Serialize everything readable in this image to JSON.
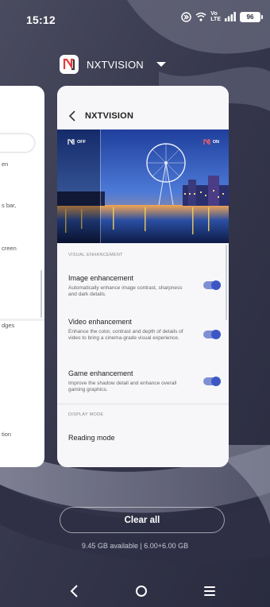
{
  "status_bar": {
    "time": "15:12",
    "network_label": "Vo\nLTE",
    "battery_level": "96"
  },
  "app_header": {
    "name": "NXTVISION"
  },
  "left_card": {
    "fragments": [
      "en",
      "s bar,",
      "creen",
      "dges",
      "tion"
    ]
  },
  "card": {
    "title": "NXTVISION",
    "hero": {
      "off_label": "OFF",
      "on_label": "ON"
    },
    "visual_section": "VISUAL ENHANCEMENT",
    "items": [
      {
        "title": "Image enhancement",
        "desc": "Automatically enhance image contrast, sharpness and dark details.",
        "enabled": true
      },
      {
        "title": "Video enhancement",
        "desc": "Enhance the color, contrast and depth of details of video to bring a cinema-grade visual experience.",
        "enabled": true
      },
      {
        "title": "Game enhancement",
        "desc": "Improve the shadow detail and enhance overall gaming graphics.",
        "enabled": true
      }
    ],
    "display_section": "DISPLAY MODE",
    "reading_mode": "Reading mode"
  },
  "clear_all": "Clear all",
  "memory_info": "9.45 GB available | 6.00+6.00 GB",
  "colors": {
    "toggle_track": "#7f8fd3",
    "toggle_knob": "#3c57c5",
    "background": "#3e3f55"
  }
}
